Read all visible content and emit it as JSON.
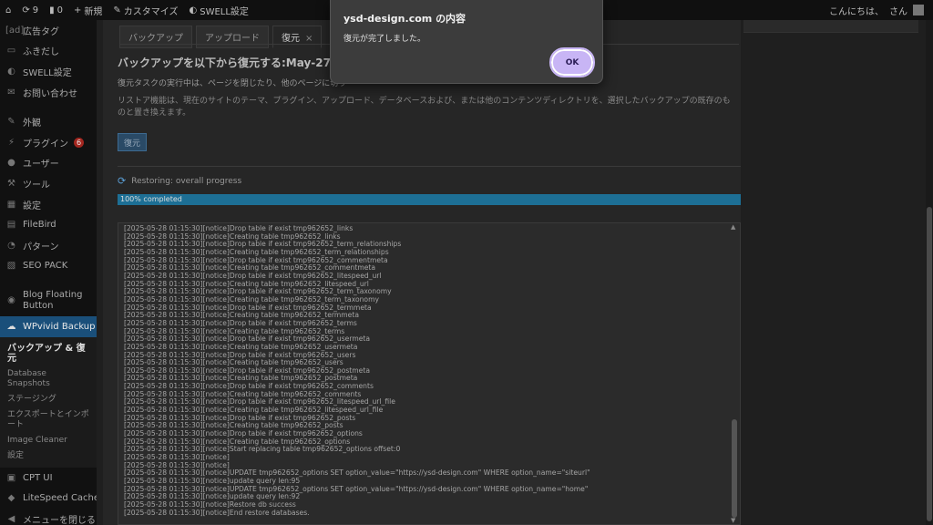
{
  "admin_bar": {
    "wp_icon": "wordpress-icon",
    "updates_count": "9",
    "comments_count": "0",
    "new_label": "新規",
    "customize_label": "カスタマイズ",
    "swell_label": "SWELL設定",
    "greeting": "こんにちは、",
    "user_suffix": "さん"
  },
  "sidebar": {
    "items_top": [
      {
        "icon": "ad-tag-icon",
        "glyph": "[ad]",
        "label": "広告タグ"
      },
      {
        "icon": "speech-bubble-icon",
        "glyph": "▭",
        "label": "ふきだし"
      },
      {
        "icon": "swell-icon",
        "glyph": "◐",
        "label": "SWELL設定"
      },
      {
        "icon": "mail-icon",
        "glyph": "✉",
        "label": "お問い合わせ"
      }
    ],
    "items_mid": [
      {
        "icon": "brush-icon",
        "glyph": "✎",
        "label": "外観"
      },
      {
        "icon": "plugin-icon",
        "glyph": "⚡",
        "label": "プラグイン",
        "badge": "6"
      },
      {
        "icon": "user-icon",
        "glyph": "●",
        "label": "ユーザー"
      },
      {
        "icon": "wrench-icon",
        "glyph": "⚒",
        "label": "ツール"
      },
      {
        "icon": "settings-icon",
        "glyph": "▦",
        "label": "設定"
      },
      {
        "icon": "folder-icon",
        "glyph": "▤",
        "label": "FileBird"
      },
      {
        "icon": "pattern-icon",
        "glyph": "◔",
        "label": "パターン"
      },
      {
        "icon": "seo-icon",
        "glyph": "▧",
        "label": "SEO PACK"
      }
    ],
    "floating_button": {
      "icon": "floating-button-icon",
      "glyph": "◉",
      "label": "Blog Floating Button"
    },
    "wpvivid": {
      "icon": "cloud-icon",
      "glyph": "☁",
      "label": "WPvivid Backup"
    },
    "submenu": [
      {
        "label": "バックアップ & 復元",
        "current": true
      },
      {
        "label": "Database Snapshots",
        "current": false
      },
      {
        "label": "ステージング",
        "current": false
      },
      {
        "label": "エクスポートとインポート",
        "current": false
      },
      {
        "label": "Image Cleaner",
        "current": false
      },
      {
        "label": "設定",
        "current": false
      }
    ],
    "items_bottom": [
      {
        "icon": "cpt-icon",
        "glyph": "▣",
        "label": "CPT UI"
      },
      {
        "icon": "litespeed-icon",
        "glyph": "◆",
        "label": "LiteSpeed Cache"
      },
      {
        "icon": "collapse-icon",
        "glyph": "◀",
        "label": "メニューを閉じる"
      }
    ]
  },
  "tabs": [
    {
      "label": "バックアップ",
      "active": false
    },
    {
      "label": "アップロード",
      "active": false
    },
    {
      "label": "復元",
      "active": true,
      "close": "×"
    }
  ],
  "restore": {
    "title": "バックアップを以下から復元する:May-27-2025",
    "note": "復元タスクの実行中は、ページを閉じたり、他のページに切り",
    "description": "リストア機能は、現在のサイトのテーマ、プラグイン、アップロード、データベースおよび、または他のコンテンツディレクトリを、選択したバックアップの既存のものと置き換えます。",
    "button_label": "復元"
  },
  "progress": {
    "label": "Restoring: overall progress",
    "percent": 100,
    "text": "100% completed"
  },
  "log_lines": [
    "[2025-05-28 01:15:30][notice]Drop table if exist tmp962652_links",
    "[2025-05-28 01:15:30][notice]Creating table tmp962652_links",
    "[2025-05-28 01:15:30][notice]Drop table if exist tmp962652_term_relationships",
    "[2025-05-28 01:15:30][notice]Creating table tmp962652_term_relationships",
    "[2025-05-28 01:15:30][notice]Drop table if exist tmp962652_commentmeta",
    "[2025-05-28 01:15:30][notice]Creating table tmp962652_commentmeta",
    "[2025-05-28 01:15:30][notice]Drop table if exist tmp962652_litespeed_url",
    "[2025-05-28 01:15:30][notice]Creating table tmp962652_litespeed_url",
    "[2025-05-28 01:15:30][notice]Drop table if exist tmp962652_term_taxonomy",
    "[2025-05-28 01:15:30][notice]Creating table tmp962652_term_taxonomy",
    "[2025-05-28 01:15:30][notice]Drop table if exist tmp962652_termmeta",
    "[2025-05-28 01:15:30][notice]Creating table tmp962652_termmeta",
    "[2025-05-28 01:15:30][notice]Drop table if exist tmp962652_terms",
    "[2025-05-28 01:15:30][notice]Creating table tmp962652_terms",
    "[2025-05-28 01:15:30][notice]Drop table if exist tmp962652_usermeta",
    "[2025-05-28 01:15:30][notice]Creating table tmp962652_usermeta",
    "[2025-05-28 01:15:30][notice]Drop table if exist tmp962652_users",
    "[2025-05-28 01:15:30][notice]Creating table tmp962652_users",
    "[2025-05-28 01:15:30][notice]Drop table if exist tmp962652_postmeta",
    "[2025-05-28 01:15:30][notice]Creating table tmp962652_postmeta",
    "[2025-05-28 01:15:30][notice]Drop table if exist tmp962652_comments",
    "[2025-05-28 01:15:30][notice]Creating table tmp962652_comments",
    "[2025-05-28 01:15:30][notice]Drop table if exist tmp962652_litespeed_url_file",
    "[2025-05-28 01:15:30][notice]Creating table tmp962652_litespeed_url_file",
    "[2025-05-28 01:15:30][notice]Drop table if exist tmp962652_posts",
    "[2025-05-28 01:15:30][notice]Creating table tmp962652_posts",
    "[2025-05-28 01:15:30][notice]Drop table if exist tmp962652_options",
    "[2025-05-28 01:15:30][notice]Creating table tmp962652_options",
    "[2025-05-28 01:15:30][notice]Start replacing table tmp962652_options offset:0",
    "[2025-05-28 01:15:30][notice]",
    "[2025-05-28 01:15:30][notice]",
    "[2025-05-28 01:15:30][notice]UPDATE tmp962652_options SET option_value=\"https://ysd-design.com\" WHERE option_name=\"siteurl\"",
    "[2025-05-28 01:15:30][notice]update query len:95",
    "[2025-05-28 01:15:30][notice]UPDATE tmp962652_options SET option_value=\"https://ysd-design.com\" WHERE option_name=\"home\"",
    "[2025-05-28 01:15:30][notice]update query len:92",
    "[2025-05-28 01:15:30][notice]Restore db success",
    "[2025-05-28 01:15:30][notice]End restore databases."
  ],
  "dialog": {
    "title": "ysd-design.com の内容",
    "message": "復元が完了しました。",
    "ok_label": "OK"
  },
  "colors": {
    "ok_button": "#c8b5f5",
    "progress_fill": "#1d6f95",
    "active_menu": "#1a4f7a"
  }
}
